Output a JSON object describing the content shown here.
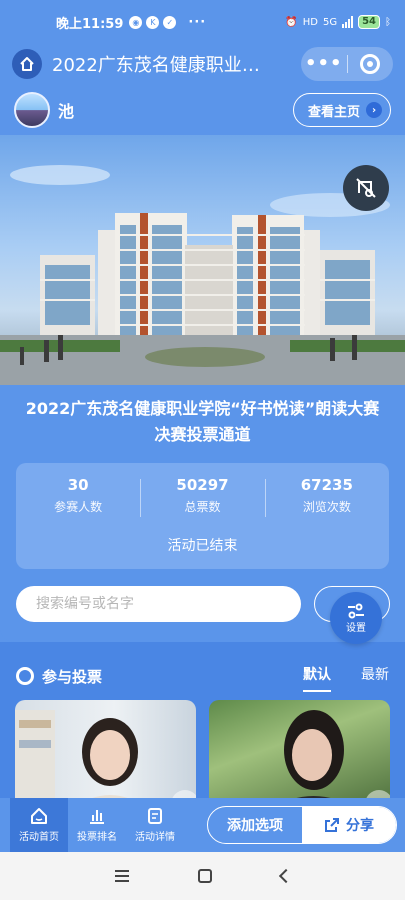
{
  "status_bar": {
    "time": "晚上11:59",
    "network": "5G",
    "hd": "HD",
    "battery": "54"
  },
  "header": {
    "title": "2022广东茂名健康职业学院“好书悦读”朗读大赛决赛投票通道"
  },
  "account": {
    "name": "池",
    "homepage_label": "查看主页"
  },
  "event": {
    "title": "2022广东茂名健康职业学院“好书悦读”朗读大赛决赛投票通道",
    "status": "活动已结束",
    "stats": [
      {
        "value": "30",
        "label": "参赛人数"
      },
      {
        "value": "50297",
        "label": "总票数"
      },
      {
        "value": "67235",
        "label": "浏览次数"
      }
    ]
  },
  "search": {
    "placeholder": "搜索编号或名字",
    "settings_label": "设置"
  },
  "vote": {
    "title": "参与投票",
    "sort_tabs": [
      {
        "label": "默认",
        "active": true
      },
      {
        "label": "最新",
        "active": false
      }
    ]
  },
  "bottom_nav": {
    "items": [
      {
        "label": "活动首页",
        "icon": "home-icon",
        "active": true
      },
      {
        "label": "投票排名",
        "icon": "bar-chart-icon",
        "active": false
      },
      {
        "label": "活动详情",
        "icon": "document-icon",
        "active": false
      }
    ],
    "add_option_label": "添加选项",
    "share_label": "分享"
  },
  "colors": {
    "primary": "#5b95ea",
    "accent": "#3572d8",
    "card": "#7aaaf0"
  }
}
